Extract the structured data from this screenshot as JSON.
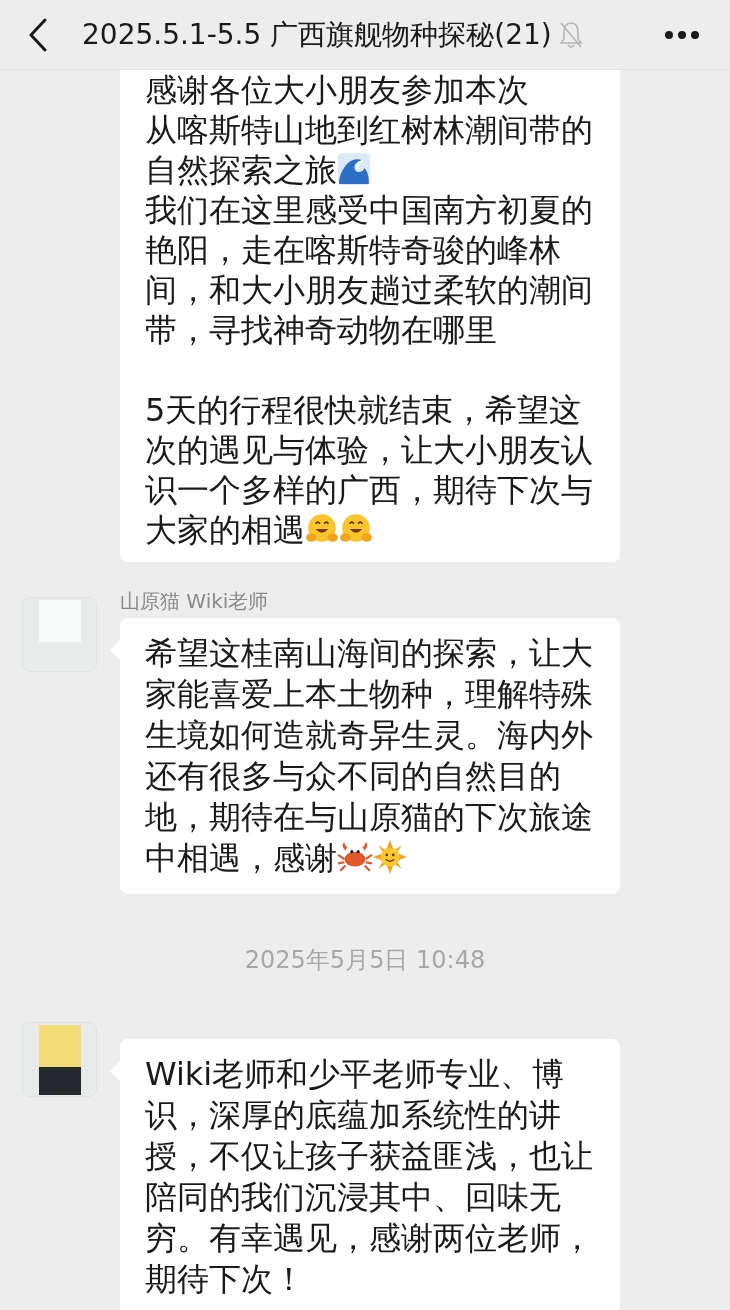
{
  "header": {
    "title": "2025.5.1-5.5 广西旗舰物种探秘(21)",
    "muted": true
  },
  "messages": [
    {
      "kind": "message",
      "cut_top": true,
      "lines": [
        {
          "kind": "line",
          "segments": [
            {
              "kind": "text",
              "text": "感谢各位大小朋友参加本次"
            }
          ]
        },
        {
          "kind": "line",
          "segments": [
            {
              "kind": "text",
              "text": "从喀斯特山地到红树林潮间带的"
            }
          ]
        },
        {
          "kind": "line",
          "segments": [
            {
              "kind": "text",
              "text": "自然探索之旅"
            },
            {
              "kind": "wave"
            }
          ]
        },
        {
          "kind": "line",
          "segments": [
            {
              "kind": "text",
              "text": "我们在这里感受中国南方初夏的艳阳，走在喀斯特奇骏的峰林间，和大小朋友趟过柔软的潮间带，寻找神奇动物在哪里"
            }
          ]
        },
        {
          "kind": "blank"
        },
        {
          "kind": "line",
          "segments": [
            {
              "kind": "text",
              "text": "5天的行程很快就结束，希望这次的遇见与体验，让大小朋友认识一个多样的广西，期待下次与大家的相遇"
            },
            {
              "kind": "hug"
            },
            {
              "kind": "hug"
            }
          ]
        }
      ]
    },
    {
      "kind": "message",
      "cut_top": false,
      "avatar": {
        "color": "#f8fbfa"
      },
      "sender": "山原猫 Wiki老师",
      "lines": [
        {
          "kind": "line",
          "segments": [
            {
              "kind": "text",
              "text": "希望这桂南山海间的探索，让大家能喜爱上本土物种，理解特殊生境如何造就奇异生灵。海内外还有很多与众不同的自然目的地，期待在与山原猫的下次旅途中相遇，感谢"
            },
            {
              "kind": "crab"
            },
            {
              "kind": "sun"
            }
          ]
        }
      ]
    },
    {
      "kind": "time",
      "text": "2025年5月5日 10:48"
    },
    {
      "kind": "message",
      "cut_top": false,
      "avatar": {
        "color": "#f4dd79"
      },
      "lines": [
        {
          "kind": "line",
          "segments": [
            {
              "kind": "text",
              "text": "Wiki老师和少平老师专业、博识，深厚的底蕴加系统性的讲授，不仅让孩子获益匪浅，也让陪同的我们沉浸其中、回味无穷。有幸遇见，感谢两位老师，期待下次！"
            }
          ]
        }
      ]
    }
  ]
}
